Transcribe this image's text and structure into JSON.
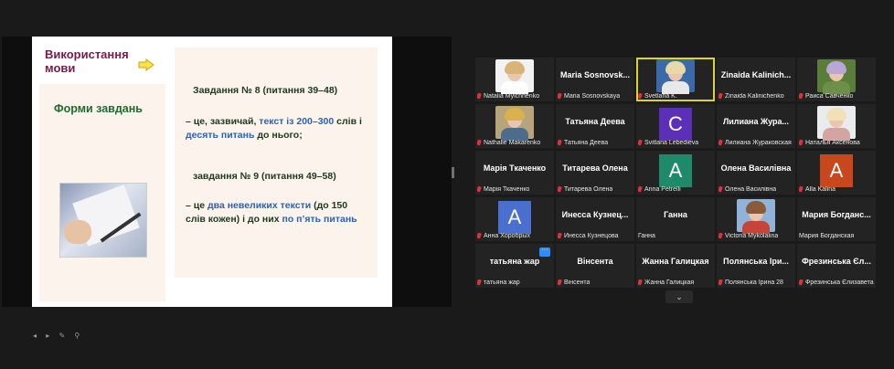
{
  "slide": {
    "title": "Використання мови",
    "left_heading": "Форми завдань",
    "task8_title": "Завдання № 8 (питання 39–48)",
    "task8_desc_1": "– це, зазвичай, ",
    "task8_desc_blue1": "текст із 200–300",
    "task8_desc_2": " слів і",
    "task8_desc_blue2": "десять питань",
    "task8_desc_3": " до нього;",
    "task9_title": "завдання № 9 (питання 49–58)",
    "task9_desc_1": "– це ",
    "task9_desc_blue1": "два невеликих тексти",
    "task9_desc_2": " (до 150",
    "task9_desc_3": "слів кожен) і до них ",
    "task9_desc_blue2": "по п’ять питань",
    "tools": "◂ ▸ ✎ ⚲"
  },
  "participants": [
    {
      "name": "Natalia Mylchnenko",
      "center": "",
      "avatar": "",
      "photo": "woman-blonde-white"
    },
    {
      "name": "Maria Sosnovskaya",
      "center": "Maria Sosnovsk...",
      "avatar": "",
      "photo": ""
    },
    {
      "name": "Svetlana K.",
      "center": "",
      "avatar": "",
      "photo": "woman-blonde-glasses",
      "active": true
    },
    {
      "name": "Zinaida Kalinichenko",
      "center": "Zinaida Kalinich...",
      "avatar": "",
      "photo": ""
    },
    {
      "name": "Раиса Савченко",
      "center": "",
      "avatar": "",
      "photo": "flowers"
    },
    {
      "name": "Nathalie Makarenko",
      "center": "",
      "avatar": "",
      "photo": "woman-blonde-smile"
    },
    {
      "name": "Татьяна Деева",
      "center": "Татьяна Деева",
      "avatar": "",
      "photo": ""
    },
    {
      "name": "Svitlana Lebedieva",
      "center": "",
      "avatar": "C",
      "avatar_color": "#5b2fb8",
      "photo": ""
    },
    {
      "name": "Лилиана Жураковская",
      "center": "Лилиана Жура...",
      "avatar": "",
      "photo": ""
    },
    {
      "name": "Наталья Аксенова",
      "center": "",
      "avatar": "",
      "photo": "woman-lightblonde"
    },
    {
      "name": "Марія Ткаченко",
      "center": "Марія Ткаченко",
      "avatar": "",
      "photo": ""
    },
    {
      "name": "Титарева Олена",
      "center": "Титарева Олена",
      "avatar": "",
      "photo": ""
    },
    {
      "name": "Anna Petrelli",
      "center": "",
      "avatar": "A",
      "avatar_color": "#1f8a6a",
      "photo": ""
    },
    {
      "name": "Олена Василівна",
      "center": "Олена Василівна",
      "avatar": "",
      "photo": ""
    },
    {
      "name": "Alla Kalina",
      "center": "",
      "avatar": "A",
      "avatar_color": "#c8471c",
      "photo": ""
    },
    {
      "name": "Анна Хоробрых",
      "center": "",
      "avatar": "A",
      "avatar_color": "#4a6fd1",
      "photo": ""
    },
    {
      "name": "Инесса Кузнецова",
      "center": "Инесса  Кузнец...",
      "avatar": "",
      "photo": ""
    },
    {
      "name": "Ганна",
      "center": "Ганна",
      "avatar": "",
      "photo": "",
      "no_mic": true
    },
    {
      "name": "Victoria Mykolaiina",
      "center": "",
      "avatar": "",
      "photo": "woman-outdoor"
    },
    {
      "name": "Мария Богданская",
      "center": "Мария  Богданс...",
      "avatar": "",
      "photo": "",
      "no_mic": true
    },
    {
      "name": "татьяна жар",
      "center": "татьяна жар",
      "avatar": "",
      "photo": "",
      "dots": "···"
    },
    {
      "name": "Вінсента",
      "center": "Вінсента",
      "avatar": "",
      "photo": ""
    },
    {
      "name": "Жанна Галицкая",
      "center": "Жанна Галицкая",
      "avatar": "",
      "photo": ""
    },
    {
      "name": "Полянська Ірина 28",
      "center": "Полянська Іри...",
      "avatar": "",
      "photo": ""
    },
    {
      "name": "Фрезинська Єлизавета",
      "center": "Фрезинська Єл...",
      "avatar": "",
      "photo": ""
    }
  ],
  "scroll_glyph": "⌄",
  "colors": {
    "active_border": "#d9d52a",
    "mic_muted": "#e0303a",
    "tile_bg": "#232323"
  }
}
